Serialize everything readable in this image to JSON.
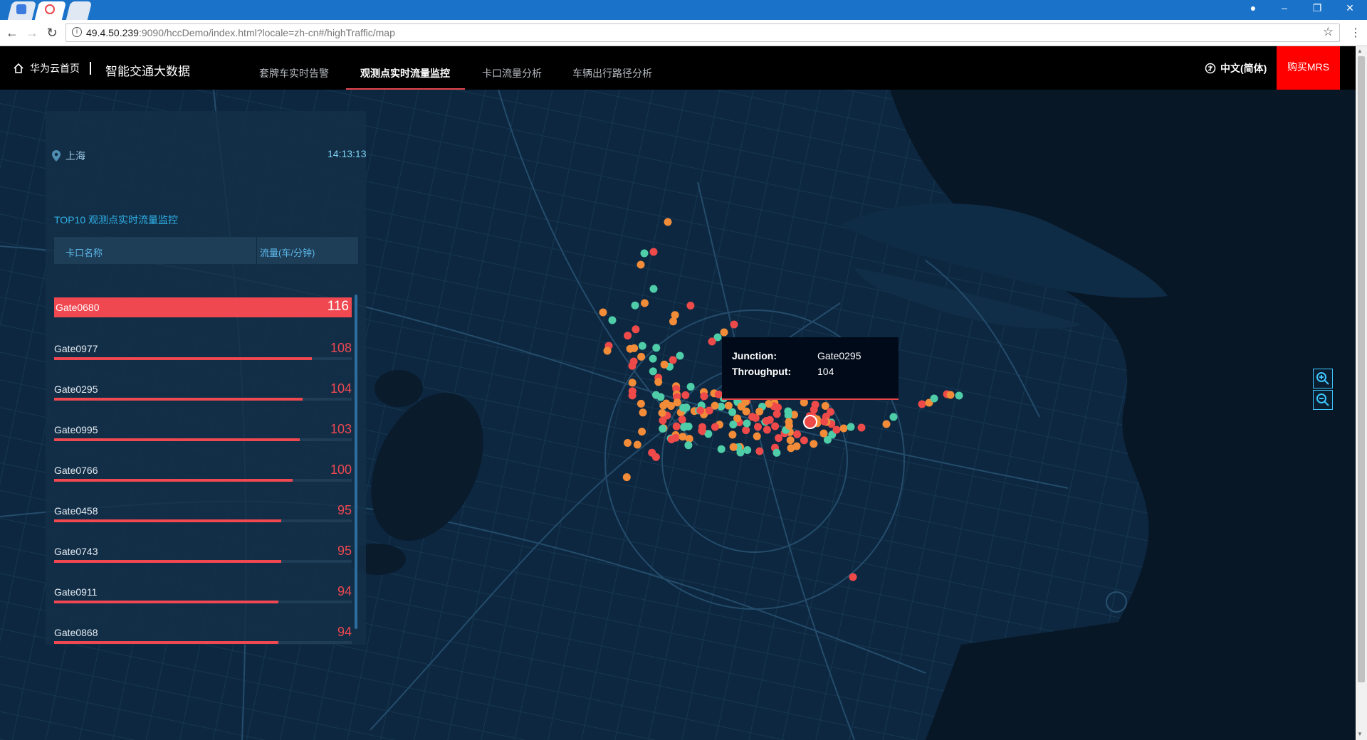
{
  "browser": {
    "url_host": "49.4.50.239",
    "url_rest": ":9090/hccDemo/index.html?locale=zh-cn#/highTraffic/map"
  },
  "header": {
    "home_label": "华为云首页",
    "app_title": "智能交通大数据",
    "menu": [
      {
        "label": "套牌车实时告警",
        "active": false
      },
      {
        "label": "观测点实时流量监控",
        "active": true
      },
      {
        "label": "卡口流量分析",
        "active": false
      },
      {
        "label": "车辆出行路径分析",
        "active": false
      }
    ],
    "language_label": "中文(简体)",
    "buy_label": "购买MRS"
  },
  "panel": {
    "city": "上海",
    "time": "14:13:13",
    "title": "TOP10 观测点实时流量监控",
    "col_name": "卡口名称",
    "col_flow": "流量(车/分钟)",
    "max_value": 116,
    "rows": [
      {
        "name": "Gate0680",
        "value": 116
      },
      {
        "name": "Gate0977",
        "value": 108
      },
      {
        "name": "Gate0295",
        "value": 104
      },
      {
        "name": "Gate0995",
        "value": 103
      },
      {
        "name": "Gate0766",
        "value": 100
      },
      {
        "name": "Gate0458",
        "value": 95
      },
      {
        "name": "Gate0743",
        "value": 95
      },
      {
        "name": "Gate0911",
        "value": 94
      },
      {
        "name": "Gate0868",
        "value": 94
      }
    ]
  },
  "tooltip": {
    "junction_label": "Junction:",
    "junction_value": "Gate0295",
    "throughput_label": "Throughput:",
    "throughput_value": "104"
  },
  "colors": {
    "high": "#ef4a4a",
    "mid": "#f28c38",
    "low": "#4ecda8",
    "accent": "#e8454a",
    "buy": "#ff0000"
  }
}
